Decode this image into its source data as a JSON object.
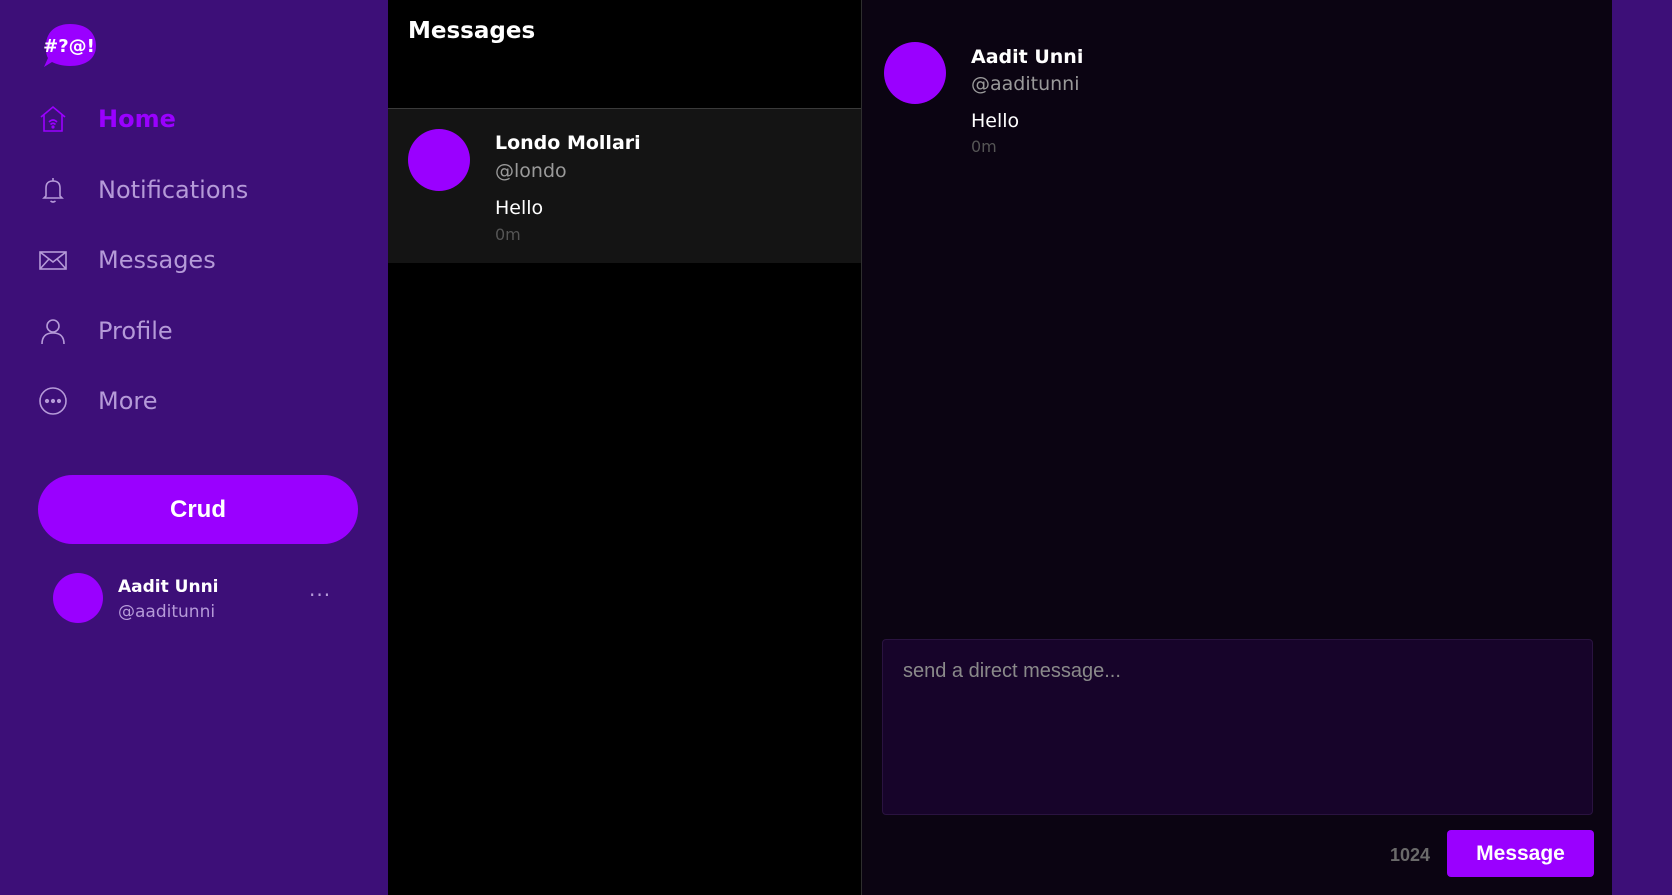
{
  "brand": {
    "logo_text": "#?@!",
    "accent_color": "#9a00ff",
    "sidebar_color": "#3d0f78"
  },
  "sidebar": {
    "items": [
      {
        "label": "Home",
        "icon": "home-icon",
        "active": true
      },
      {
        "label": "Notifications",
        "icon": "bell-icon",
        "active": false
      },
      {
        "label": "Messages",
        "icon": "envelope-icon",
        "active": false
      },
      {
        "label": "Profile",
        "icon": "user-icon",
        "active": false
      },
      {
        "label": "More",
        "icon": "more-circle-icon",
        "active": false
      }
    ],
    "compose_label": "Crud",
    "account": {
      "name": "Aadit Unni",
      "handle": "@aaditunni",
      "more": "···"
    }
  },
  "messages_list": {
    "title": "Messages",
    "conversations": [
      {
        "name": "Londo Mollari",
        "handle": "@londo",
        "text": "Hello",
        "time": "0m"
      }
    ]
  },
  "chat": {
    "messages": [
      {
        "name": "Aadit Unni",
        "handle": "@aaditunni",
        "text": "Hello",
        "time": "0m"
      }
    ],
    "input_placeholder": "send a direct message...",
    "char_count": "1024",
    "send_label": "Message"
  }
}
